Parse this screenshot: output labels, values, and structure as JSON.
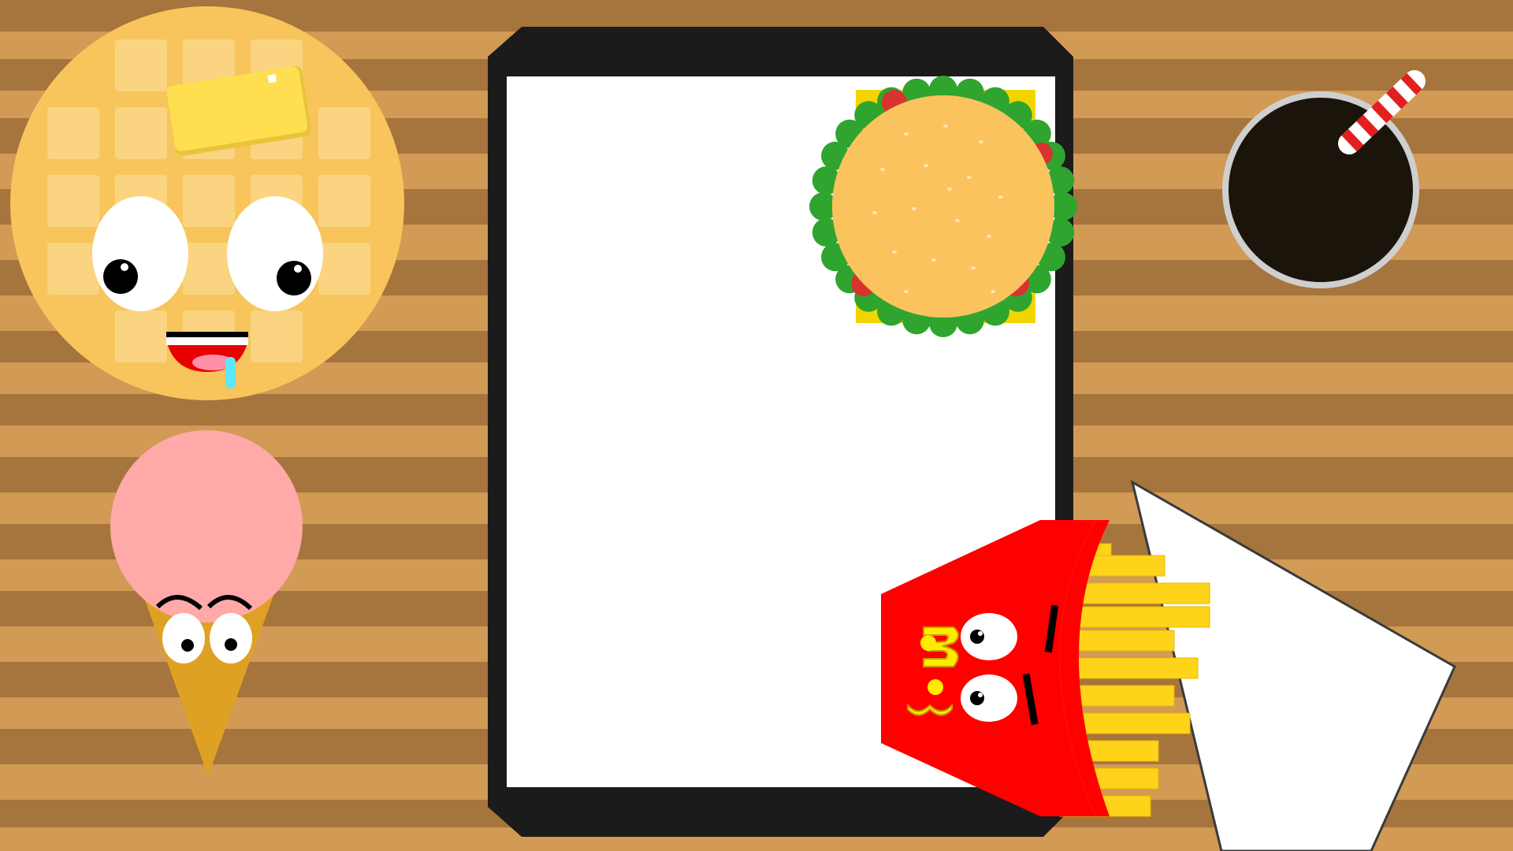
{
  "scene": {
    "table": {
      "plank_light": "#d19a55",
      "plank_dark": "#a6743d"
    },
    "tablet": {
      "frame_color": "#1a1a1a",
      "screen_color": "#ffffff"
    },
    "characters": [
      {
        "name": "waffle",
        "color": "#f7c55c"
      },
      {
        "name": "butter",
        "color": "#ffdf4f"
      },
      {
        "name": "ice-cream",
        "scoop_color": "#ffa9a9",
        "cone_color": "#dfa123"
      },
      {
        "name": "burger",
        "bun_color": "#fbc35e",
        "lettuce_color": "#2fa52f",
        "cheese_color": "#f2d500"
      },
      {
        "name": "soda",
        "drink_color": "#1b140b",
        "straw_color": "#e31f1f"
      },
      {
        "name": "fries",
        "box_color": "#ff0000",
        "logo_color": "#ffea00",
        "fry_color": "#ffd319"
      },
      {
        "name": "napkin",
        "color": "#ffffff"
      }
    ]
  }
}
